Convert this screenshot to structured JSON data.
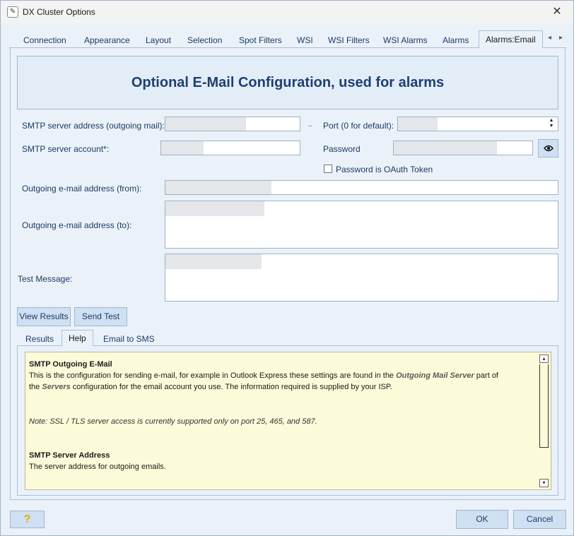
{
  "window": {
    "title": "DX Cluster Options",
    "close_glyph": "✕",
    "app_icon": "dx-cluster-app-icon"
  },
  "tabs": [
    {
      "label": "Connection"
    },
    {
      "label": "Appearance"
    },
    {
      "label": "Layout"
    },
    {
      "label": "Selection"
    },
    {
      "label": "Spot Filters"
    },
    {
      "label": "WSI"
    },
    {
      "label": "WSI Filters"
    },
    {
      "label": "WSI Alarms"
    },
    {
      "label": "Alarms"
    },
    {
      "label": "Alarms:Email",
      "active": true
    }
  ],
  "tab_nav": {
    "left": "◂",
    "right": "▸"
  },
  "heading": "Optional E-Mail Configuration, used for alarms",
  "form": {
    "smtp_server_label": "SMTP server address (outgoing mail):",
    "ellipsis": "..",
    "port_label": "Port (0 for default):",
    "smtp_account_label": "SMTP server account*:",
    "password_label": "Password",
    "oauth_label": "Password is OAuth Token",
    "oauth_checked": false,
    "from_label": "Outgoing e-mail address (from):",
    "to_label": "Outgoing e-mail address (to):",
    "test_message_label": "Test Message:"
  },
  "buttons": {
    "view_results": "View Results",
    "send_test": "Send Test",
    "ok": "OK",
    "cancel": "Cancel",
    "help_glyph": "?"
  },
  "subtabs": [
    {
      "label": "Results"
    },
    {
      "label": "Help",
      "active": true
    },
    {
      "label": "Email to SMS"
    }
  ],
  "help": {
    "title1": "SMTP Outgoing E-Mail",
    "p1_a": "This is the configuration for sending e-mail, for example in Outlook Express these settings are found in the ",
    "p1_hl1": "Outgoing Mail Server",
    "p1_b": " part of",
    "p1_c": "the ",
    "p1_hl2": "Servers",
    "p1_d": " configuration for the email account you use. The information required is supplied by your ISP.",
    "note": "Note: SSL / TLS server access is currently supported only on port 25, 465, and 587.",
    "title2": "SMTP Server Address",
    "p2": "The server address for outgoing emails."
  },
  "scroll": {
    "up": "▴",
    "down": "▾"
  },
  "colors": {
    "heading": "#1e3f73",
    "accent": "#1d3b66",
    "help_bg": "#fcfbd9",
    "button_bg": "#cfe0f2"
  }
}
